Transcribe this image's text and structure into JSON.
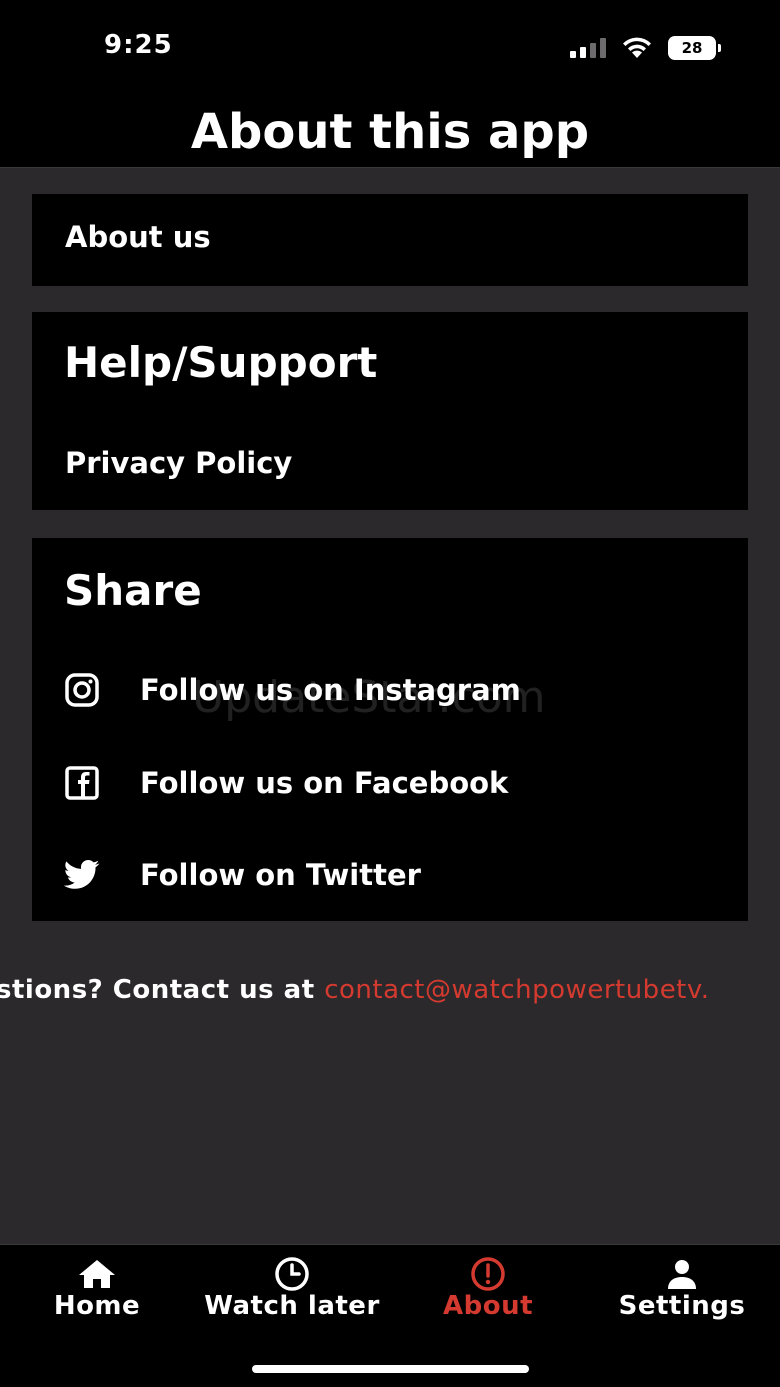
{
  "status_bar": {
    "time": "9:25",
    "battery": "28",
    "icons": [
      "cellular-signal-icon",
      "wifi-icon",
      "battery-icon"
    ]
  },
  "header": {
    "title": "About this app"
  },
  "about_card": {
    "about_us": "About us"
  },
  "help_card": {
    "heading": "Help/Support",
    "privacy_policy": "Privacy Policy"
  },
  "share_card": {
    "heading": "Share",
    "items": [
      {
        "icon": "instagram-icon",
        "label": "Follow us on Instagram"
      },
      {
        "icon": "facebook-icon",
        "label": "Follow us on Facebook"
      },
      {
        "icon": "twitter-icon",
        "label": "Follow on Twitter"
      }
    ]
  },
  "watermark": "UpdateStar.com",
  "contact": {
    "prefix": "stions? Contact us at ",
    "email": "contact@watchpowertubetv."
  },
  "tabbar": {
    "tabs": [
      {
        "label": "Home",
        "icon": "home-icon",
        "active": false
      },
      {
        "label": "Watch later",
        "icon": "clock-icon",
        "active": false
      },
      {
        "label": "About",
        "icon": "exclamation-circle-icon",
        "active": true
      },
      {
        "label": "Settings",
        "icon": "person-icon",
        "active": false
      }
    ]
  },
  "colors": {
    "background": "#2b292b",
    "card": "#000000",
    "accent": "#d43a2f",
    "text": "#ffffff"
  }
}
